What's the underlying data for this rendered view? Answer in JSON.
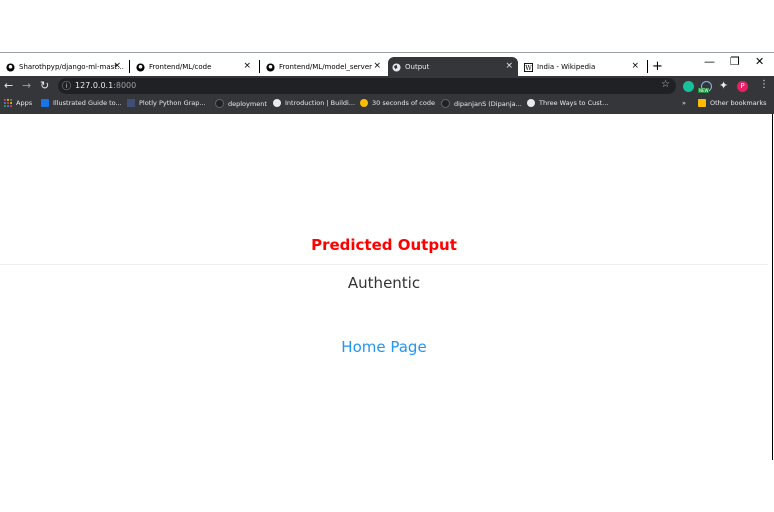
{
  "browser": {
    "tabs": [
      {
        "title": "Sharothpyp/django-ml-master • Pr",
        "icon": "github-icon",
        "active": false
      },
      {
        "title": "Frontend/ML/code",
        "icon": "github-icon",
        "active": false
      },
      {
        "title": "Frontend/ML/model_server",
        "icon": "github-icon",
        "active": false
      },
      {
        "title": "Output",
        "icon": "globe-icon",
        "active": true
      },
      {
        "title": "India - Wikipedia",
        "icon": "wikipedia-icon",
        "active": false
      }
    ],
    "tab_close_glyph": "×",
    "new_tab_glyph": "+",
    "window_controls": {
      "minimize": "—",
      "restore": "❐",
      "close": "✕"
    },
    "url_host": "127.0.0.1",
    "url_port": ":8000",
    "bookmarks": [
      {
        "label": "Apps",
        "icon": "apps-grid-icon",
        "color": "#ea4335"
      },
      {
        "label": "Illustrated Guide to...",
        "icon": "site-icon",
        "color": "#1a73e8"
      },
      {
        "label": "Plotly Python Grap...",
        "icon": "plotly-icon",
        "color": "#3f4f75"
      },
      {
        "label": "deployment",
        "icon": "github-icon",
        "color": "#202124"
      },
      {
        "label": "Introduction | Buildi...",
        "icon": "globe-icon",
        "color": "#e8eaed"
      },
      {
        "label": "30 seconds of code",
        "icon": "site-icon",
        "color": "#fbbc04"
      },
      {
        "label": "dipanjanS (Dipanja...",
        "icon": "github-icon",
        "color": "#202124"
      },
      {
        "label": "Three Ways to Cust...",
        "icon": "globe-icon",
        "color": "#e8eaed"
      }
    ],
    "bookmarks_overflow": "»",
    "other_bookmarks": "Other bookmarks",
    "extension_badge": "NEW",
    "profile_initial": "P"
  },
  "page": {
    "heading": "Predicted Output",
    "result": "Authentic",
    "home_link": "Home Page",
    "heading_color": "#ff0000",
    "link_color": "#2196f3"
  }
}
